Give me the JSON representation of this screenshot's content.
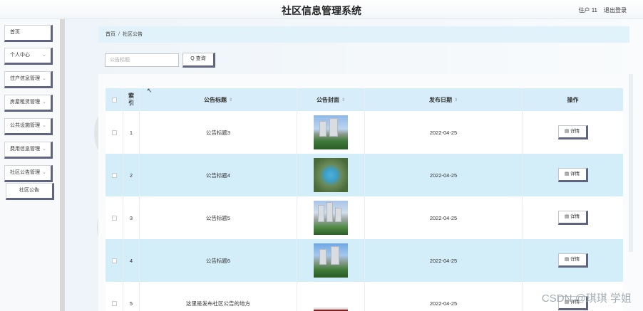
{
  "header": {
    "title": "社区信息管理系统",
    "user": "住户 11",
    "logout": "退出登录"
  },
  "sidebar": {
    "items": [
      {
        "label": "首页"
      },
      {
        "label": "个人中心",
        "chevron": "⌄"
      },
      {
        "label": "住户信息管理",
        "chevron": "⌄"
      },
      {
        "label": "房屋租赁管理",
        "chevron": "⌄"
      },
      {
        "label": "公共设施管理",
        "chevron": "⌄"
      },
      {
        "label": "费用信息管理",
        "chevron": "⌄"
      },
      {
        "label": "社区公告管理",
        "chevron": "⌄"
      }
    ],
    "subitem": "社区公告"
  },
  "breadcrumb": {
    "home": "首页",
    "sep": "/",
    "current": "社区公告"
  },
  "search": {
    "placeholder": "公告标题",
    "button": "Q 查询"
  },
  "table": {
    "columns": {
      "index": "索引",
      "title": "公告标题",
      "cover": "公告封面",
      "date": "发布日期",
      "op": "操作"
    },
    "sort_icon": "⇕",
    "rows": [
      {
        "index": "1",
        "title": "公告标题3",
        "date": "2022-04-25",
        "detail": "▤ 详情"
      },
      {
        "index": "2",
        "title": "公告标题4",
        "date": "2022-04-25",
        "detail": "▤ 详情"
      },
      {
        "index": "3",
        "title": "公告标题5",
        "date": "2022-04-25",
        "detail": "▤ 详情"
      },
      {
        "index": "4",
        "title": "公告标题6",
        "date": "2022-04-25",
        "detail": "▤ 详情"
      },
      {
        "index": "5",
        "title": "这里是发布社区公告的地方",
        "date": "2022-04-25",
        "detail": "▤ 详情"
      }
    ]
  },
  "watermark": "CSDN @琪琪 学姐",
  "colors": {
    "header_row": "#d7eefa",
    "alt_row": "#d4eef9",
    "button_shadow": "#5f6580",
    "breadcrumb_bg": "#e2f2fb"
  }
}
